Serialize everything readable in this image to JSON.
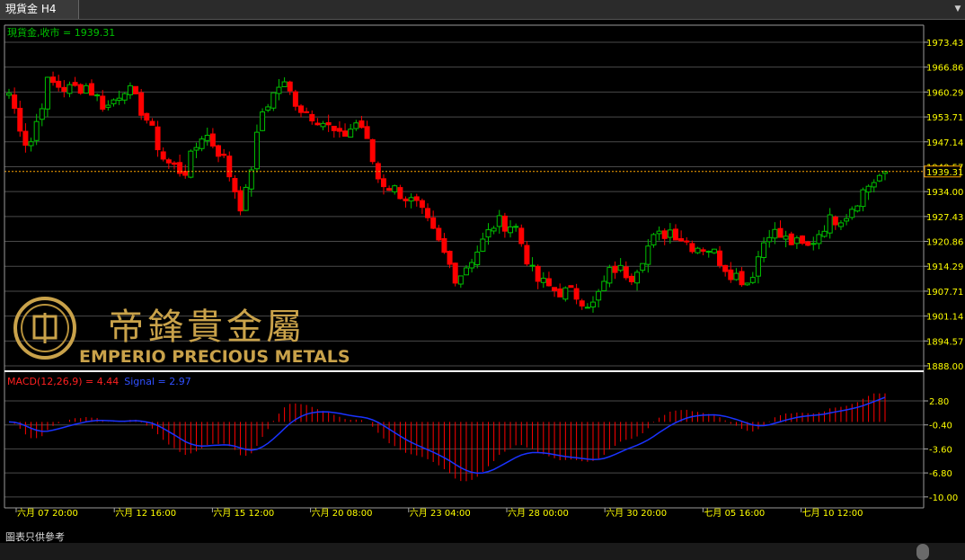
{
  "tab": {
    "title": "現貨金 H4"
  },
  "price_legend": "現貨金,收市 = 1939.31",
  "macd_legend": {
    "label": "MACD(12,26,9) = 4.44",
    "signal": "Signal = 2.97"
  },
  "brand": {
    "chinese": "帝鋒貴金屬",
    "english": "EMPERIO PRECIOUS METALS"
  },
  "disclaimer": "圖表只供參考",
  "colors": {
    "up": "#00c000",
    "down": "#ff0000",
    "grid": "#4a4a4a",
    "axis_text": "#ffff00",
    "macd_hist": "#ff0000",
    "signal": "#1a33ff",
    "current_price_line": "#ffa500",
    "gold": "#c9a24a"
  },
  "chart_data": [
    {
      "type": "candlestick",
      "title": "現貨金 H4",
      "series": [
        {
          "name": "現貨金,收市",
          "last_close": 1939.31
        }
      ],
      "ylim": [
        1888.0,
        1973.43
      ],
      "y_ticks": [
        "1973.43",
        "1966.86",
        "1960.29",
        "1953.71",
        "1947.14",
        "1940.57",
        "1934.00",
        "1927.43",
        "1920.86",
        "1914.29",
        "1907.71",
        "1901.14",
        "1894.57",
        "1888.00"
      ],
      "current_price_label": "1939.31",
      "x_tick_labels": [
        "六月 07 20:00",
        "六月 12 16:00",
        "六月 15 12:00",
        "六月 20 08:00",
        "六月 23 04:00",
        "六月 28 00:00",
        "六月 30 20:00",
        "七月 05 16:00",
        "七月 10 12:00"
      ],
      "close_path": [
        1960,
        1945,
        1963,
        1961,
        1962,
        1956,
        1962,
        1954,
        1942,
        1939,
        1950,
        1943,
        1929,
        1955,
        1963,
        1956,
        1953,
        1948,
        1953,
        1937,
        1934,
        1930,
        1921,
        1911,
        1918,
        1926,
        1925,
        1911,
        1908,
        1907,
        1904,
        1914,
        1912,
        1921,
        1924,
        1920,
        1919,
        1913,
        1910,
        1924,
        1921,
        1919,
        1926,
        1928,
        1935,
        1939.31
      ],
      "grid": true
    },
    {
      "type": "bar",
      "title": "MACD(12,26,9)",
      "series": [
        {
          "name": "MACD(12,26,9)",
          "last": 4.44
        },
        {
          "name": "Signal",
          "last": 2.97
        }
      ],
      "ylim": [
        -10.5,
        4.0
      ],
      "y_ticks": [
        "2.80",
        "-0.40",
        "-3.60",
        "-6.80",
        "-10.00"
      ],
      "grid": true
    }
  ]
}
